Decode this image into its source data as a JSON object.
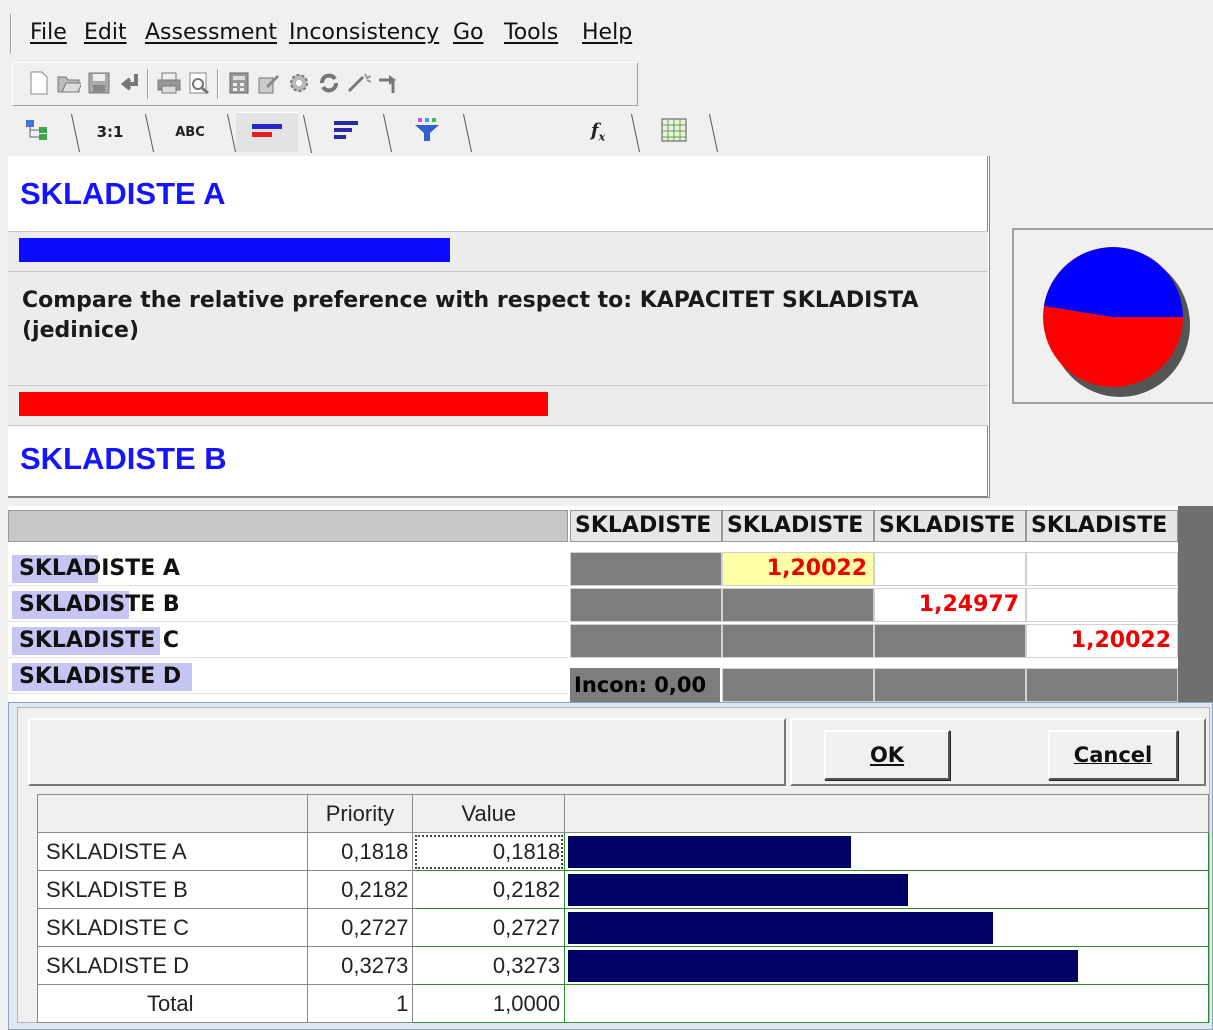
{
  "menu": [
    "File",
    "Edit",
    "Assessment",
    "Inconsistency",
    "Go",
    "Tools",
    "Help"
  ],
  "toolbar_icons": [
    "new-icon",
    "open-icon",
    "save-icon",
    "import-icon",
    "print-icon",
    "print-preview-icon",
    "calculator-icon",
    "edit-icon",
    "settings-icon",
    "sync-icon",
    "wand-icon",
    "arrow-icon"
  ],
  "tabs": [
    {
      "label": "",
      "icon": "tree-icon"
    },
    {
      "label": "3:1",
      "icon": ""
    },
    {
      "label": "ABC",
      "icon": ""
    },
    {
      "label": "",
      "icon": "bar-compare-icon",
      "active": true
    },
    {
      "label": "",
      "icon": "bars-icon"
    },
    {
      "label": "",
      "icon": "funnel-icon"
    },
    {
      "label": "",
      "icon": "formula-icon"
    },
    {
      "label": "",
      "icon": "grid-icon"
    }
  ],
  "comparison": {
    "top_alternative": "SKLADISTE A",
    "bottom_alternative": "SKLADISTE B",
    "question": "Compare the relative preference with respect to: KAPACITET SKLADISTA (jedinice)",
    "top_bar_fraction": 0.44,
    "bottom_bar_fraction": 0.54,
    "top_color": "#0a0aff",
    "bottom_color": "#ff0000"
  },
  "pie": {
    "blue_fraction": 0.455,
    "colors": [
      "#0000ff",
      "#ff0000"
    ]
  },
  "matrix": {
    "columns": [
      "SKLADISTE",
      "SKLADISTE",
      "SKLADISTE",
      "SKLADISTE"
    ],
    "rows": [
      {
        "label": "SKLADISTE A",
        "highlight": "SKLADI"
      },
      {
        "label": "SKLADISTE B",
        "highlight": "SKLADIS"
      },
      {
        "label": "SKLADISTE C",
        "highlight": "SKLADISTE"
      },
      {
        "label": "SKLADISTE D",
        "highlight": "SKLADISTE D"
      }
    ],
    "values": {
      "ab": "1,20022",
      "bc": "1,24977",
      "cd": "1,20022"
    },
    "inconsistency": "Incon: 0,00"
  },
  "dialog": {
    "ok_label": "OK",
    "cancel_label": "Cancel",
    "headers": {
      "priority": "Priority",
      "value": "Value"
    },
    "rows": [
      {
        "name": "SKLADISTE A",
        "priority": "0,1818",
        "value": "0,1818",
        "fraction": 0.1818
      },
      {
        "name": "SKLADISTE B",
        "priority": "0,2182",
        "value": "0,2182",
        "fraction": 0.2182
      },
      {
        "name": "SKLADISTE C",
        "priority": "0,2727",
        "value": "0,2727",
        "fraction": 0.2727
      },
      {
        "name": "SKLADISTE D",
        "priority": "0,3273",
        "value": "0,3273",
        "fraction": 0.3273
      }
    ],
    "total": {
      "name": "Total",
      "priority": "1",
      "value": "1,0000"
    },
    "bar_color": "#000066"
  }
}
